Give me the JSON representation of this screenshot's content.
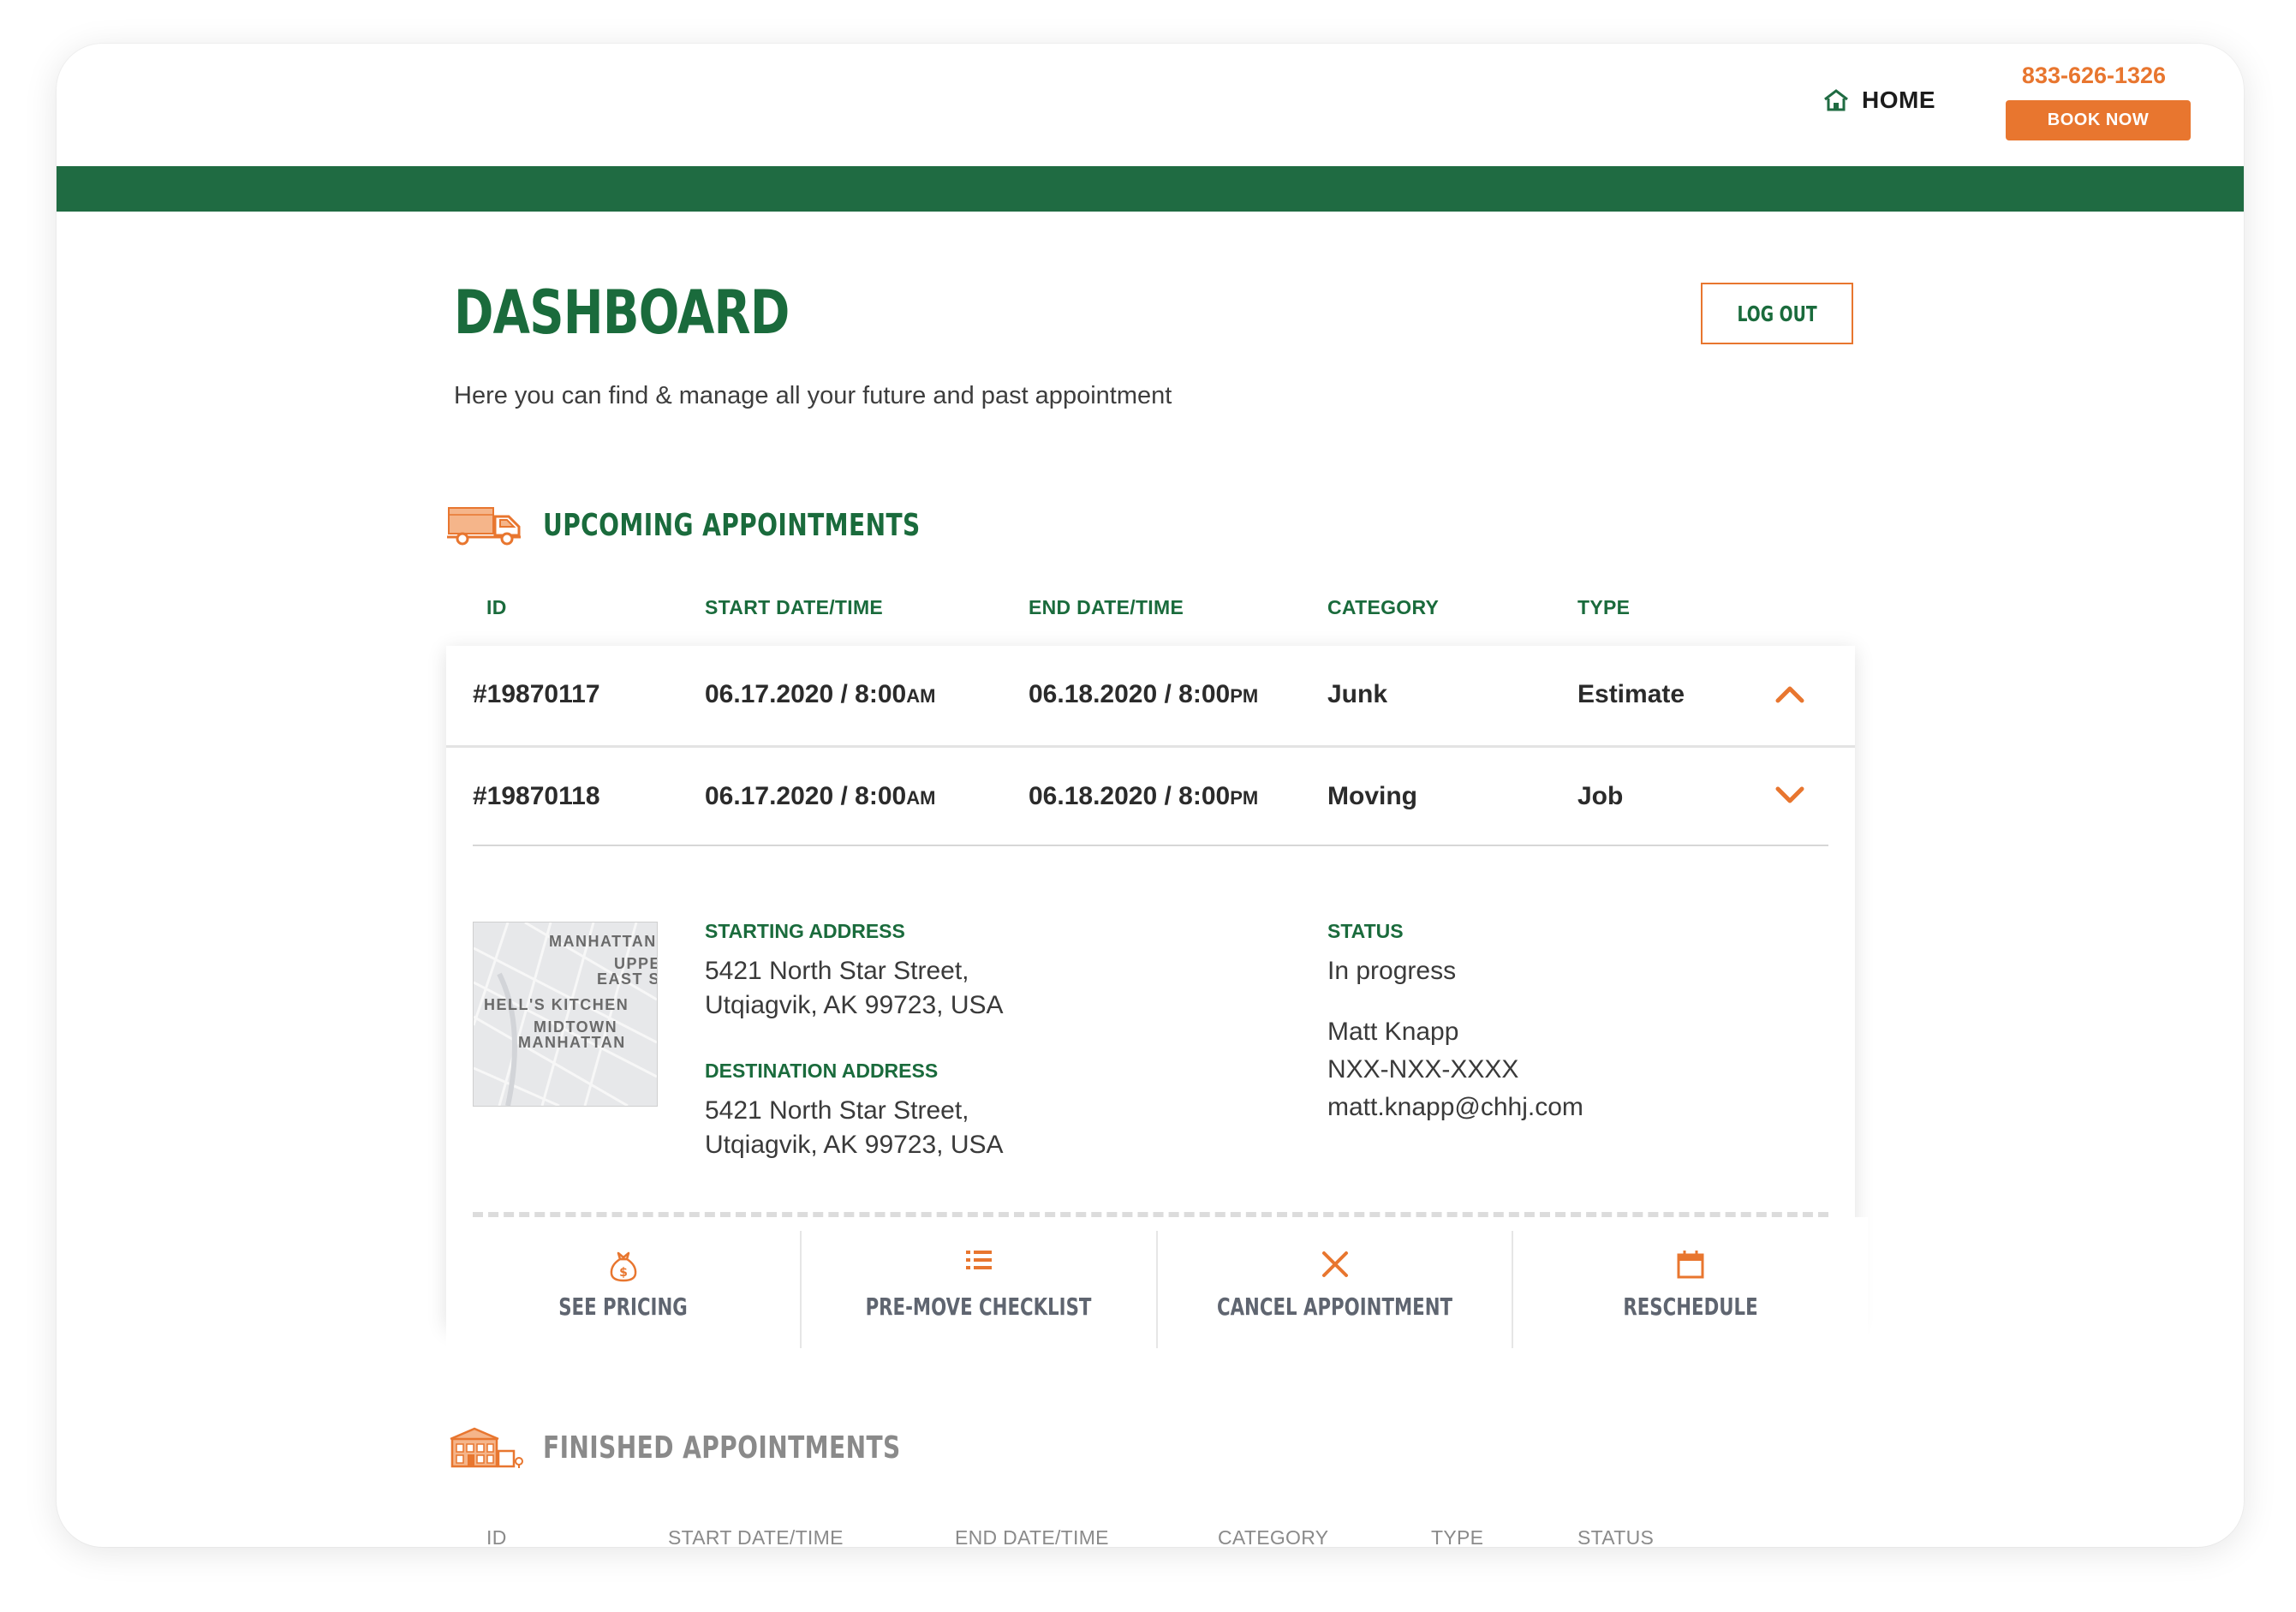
{
  "header": {
    "home_label": "HOME",
    "phone": "833-626-1326",
    "book_label": "BOOK NOW",
    "brand_green": "#1f6b42",
    "accent_orange": "#e8762f"
  },
  "page": {
    "title": "DASHBOARD",
    "subtitle": "Here you can find & manage all your future and past appointment",
    "logout_label": "LOG OUT"
  },
  "upcoming": {
    "title": "UPCOMING APPOINTMENTS",
    "icon": "truck-icon",
    "columns": {
      "id": "ID",
      "start": "START DATE/TIME",
      "end": "END DATE/TIME",
      "category": "CATEGORY",
      "type": "TYPE"
    },
    "rows": [
      {
        "id": "#19870117",
        "start_date": "06.17.2020 / 8:00",
        "start_ampm": "AM",
        "end_date": "06.18.2020 / 8:00",
        "end_ampm": "PM",
        "category": "Junk",
        "type": "Estimate",
        "chevron": "chevron-up-icon"
      },
      {
        "id": "#19870118",
        "start_date": "06.17.2020 / 8:00",
        "start_ampm": "AM",
        "end_date": "06.18.2020 / 8:00",
        "end_ampm": "PM",
        "category": "Moving",
        "type": "Job",
        "chevron": "chevron-down-icon"
      }
    ],
    "details": {
      "map_labels": [
        "MANHATTAN",
        "UPPER",
        "EAST S",
        "HELL'S KITCHEN",
        "MIDTOWN",
        "MANHATTAN"
      ],
      "starting_address_label": "STARTING ADDRESS",
      "starting_address_line1": "5421 North Star Street,",
      "starting_address_line2": "Utqiagvik, AK 99723, USA",
      "destination_address_label": "DESTINATION ADDRESS",
      "destination_address_line1": "5421 North Star Street,",
      "destination_address_line2": "Utqiagvik, AK 99723, USA",
      "status_label": "STATUS",
      "status_value": "In progress",
      "contact_name": "Matt Knapp",
      "contact_phone": "NXX-NXX-XXXX",
      "contact_email": "matt.knapp@chhj.com"
    },
    "actions": [
      {
        "label": "SEE PRICING",
        "icon": "money-bag-icon"
      },
      {
        "label": "PRE-MOVE CHECKLIST",
        "icon": "checklist-icon"
      },
      {
        "label": "CANCEL APPOINTMENT",
        "icon": "close-icon"
      },
      {
        "label": "RESCHEDULE",
        "icon": "calendar-icon"
      }
    ]
  },
  "finished": {
    "title": "FINISHED APPOINTMENTS",
    "icon": "storefront-icon",
    "columns": {
      "id": "ID",
      "start": "START DATE/TIME",
      "end": "END DATE/TIME",
      "category": "CATEGORY",
      "type": "TYPE",
      "status": "STATUS"
    }
  }
}
